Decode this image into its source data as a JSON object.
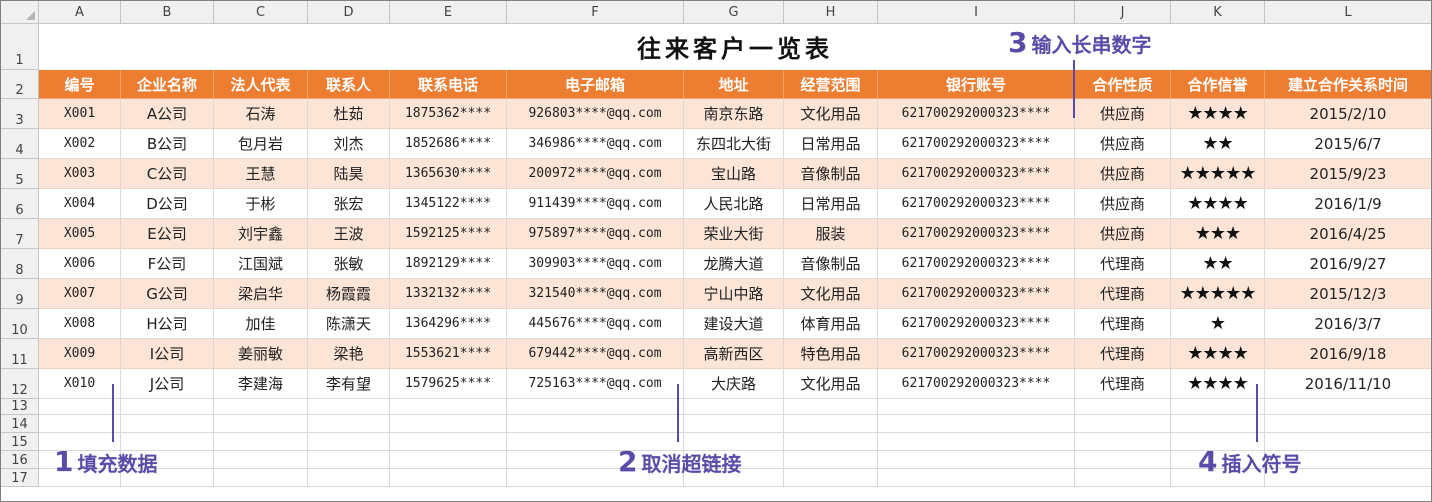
{
  "column_letters": [
    "A",
    "B",
    "C",
    "D",
    "E",
    "F",
    "G",
    "H",
    "I",
    "J",
    "K",
    "L"
  ],
  "row_numbers": [
    "1",
    "2",
    "3",
    "4",
    "5",
    "6",
    "7",
    "8",
    "9",
    "10",
    "11",
    "12",
    "13",
    "14",
    "15",
    "16",
    "17"
  ],
  "title": "往来客户一览表",
  "headers": [
    "编号",
    "企业名称",
    "法人代表",
    "联系人",
    "联系电话",
    "电子邮箱",
    "地址",
    "经营范围",
    "银行账号",
    "合作性质",
    "合作信誉",
    "建立合作关系时间"
  ],
  "rows": [
    [
      "X001",
      "A公司",
      "石涛",
      "杜茹",
      "1875362****",
      "926803****@qq.com",
      "南京东路",
      "文化用品",
      "621700292000323****",
      "供应商",
      "★★★★",
      "2015/2/10"
    ],
    [
      "X002",
      "B公司",
      "包月岩",
      "刘杰",
      "1852686****",
      "346986****@qq.com",
      "东四北大街",
      "日常用品",
      "621700292000323****",
      "供应商",
      "★★",
      "2015/6/7"
    ],
    [
      "X003",
      "C公司",
      "王慧",
      "陆昊",
      "1365630****",
      "200972****@qq.com",
      "宝山路",
      "音像制品",
      "621700292000323****",
      "供应商",
      "★★★★★",
      "2015/9/23"
    ],
    [
      "X004",
      "D公司",
      "于彬",
      "张宏",
      "1345122****",
      "911439****@qq.com",
      "人民北路",
      "日常用品",
      "621700292000323****",
      "供应商",
      "★★★★",
      "2016/1/9"
    ],
    [
      "X005",
      "E公司",
      "刘宇鑫",
      "王波",
      "1592125****",
      "975897****@qq.com",
      "荣业大街",
      "服装",
      "621700292000323****",
      "供应商",
      "★★★",
      "2016/4/25"
    ],
    [
      "X006",
      "F公司",
      "江国斌",
      "张敏",
      "1892129****",
      "309903****@qq.com",
      "龙腾大道",
      "音像制品",
      "621700292000323****",
      "代理商",
      "★★",
      "2016/9/27"
    ],
    [
      "X007",
      "G公司",
      "梁启华",
      "杨霞霞",
      "1332132****",
      "321540****@qq.com",
      "宁山中路",
      "文化用品",
      "621700292000323****",
      "代理商",
      "★★★★★",
      "2015/12/3"
    ],
    [
      "X008",
      "H公司",
      "加佳",
      "陈潇天",
      "1364296****",
      "445676****@qq.com",
      "建设大道",
      "体育用品",
      "621700292000323****",
      "代理商",
      "★",
      "2016/3/7"
    ],
    [
      "X009",
      "I公司",
      "姜丽敏",
      "梁艳",
      "1553621****",
      "679442****@qq.com",
      "高新西区",
      "特色用品",
      "621700292000323****",
      "代理商",
      "★★★★",
      "2016/9/18"
    ],
    [
      "X010",
      "J公司",
      "李建海",
      "李有望",
      "1579625****",
      "725163****@qq.com",
      "大庆路",
      "文化用品",
      "621700292000323****",
      "代理商",
      "★★★★",
      "2016/11/10"
    ]
  ],
  "callouts": {
    "c1": {
      "num": "1",
      "text": "填充数据"
    },
    "c2": {
      "num": "2",
      "text": "取消超链接"
    },
    "c3": {
      "num": "3",
      "text": "输入长串数字"
    },
    "c4": {
      "num": "4",
      "text": "插入符号"
    }
  },
  "colors": {
    "header_fill": "#ed7d31",
    "band_fill": "#fce4d6",
    "callout": "#5b4aa8"
  }
}
